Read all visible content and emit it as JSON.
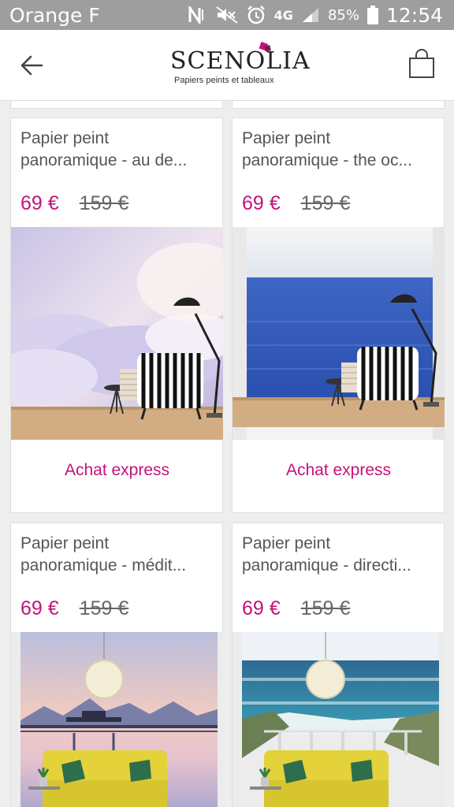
{
  "status_bar": {
    "carrier": "Orange F",
    "network": "4G",
    "battery": "85%",
    "time": "12:54"
  },
  "header": {
    "brand": "SCENOLIA",
    "tagline": "Papiers peints et tableaux",
    "back_icon": "arrow-left-icon",
    "cart_icon": "shopping-bag-icon"
  },
  "colors": {
    "accent": "#c2137a",
    "status_bar": "#9e9e9e"
  },
  "products": [
    {
      "title_line1": "Papier peint",
      "title_line2": "panoramique - au de...",
      "price": "69 €",
      "old_price": "159 €",
      "cta": "Achat express",
      "scene": "clouds"
    },
    {
      "title_line1": "Papier peint",
      "title_line2": "panoramique - the oc...",
      "price": "69 €",
      "old_price": "159 €",
      "cta": "Achat express",
      "scene": "ocean"
    },
    {
      "title_line1": "Papier peint",
      "title_line2": "panoramique - médit...",
      "price": "69 €",
      "old_price": "159 €",
      "scene": "meditation"
    },
    {
      "title_line1": "Papier peint",
      "title_line2": "panoramique - directi...",
      "price": "69 €",
      "old_price": "159 €",
      "scene": "beach"
    }
  ]
}
